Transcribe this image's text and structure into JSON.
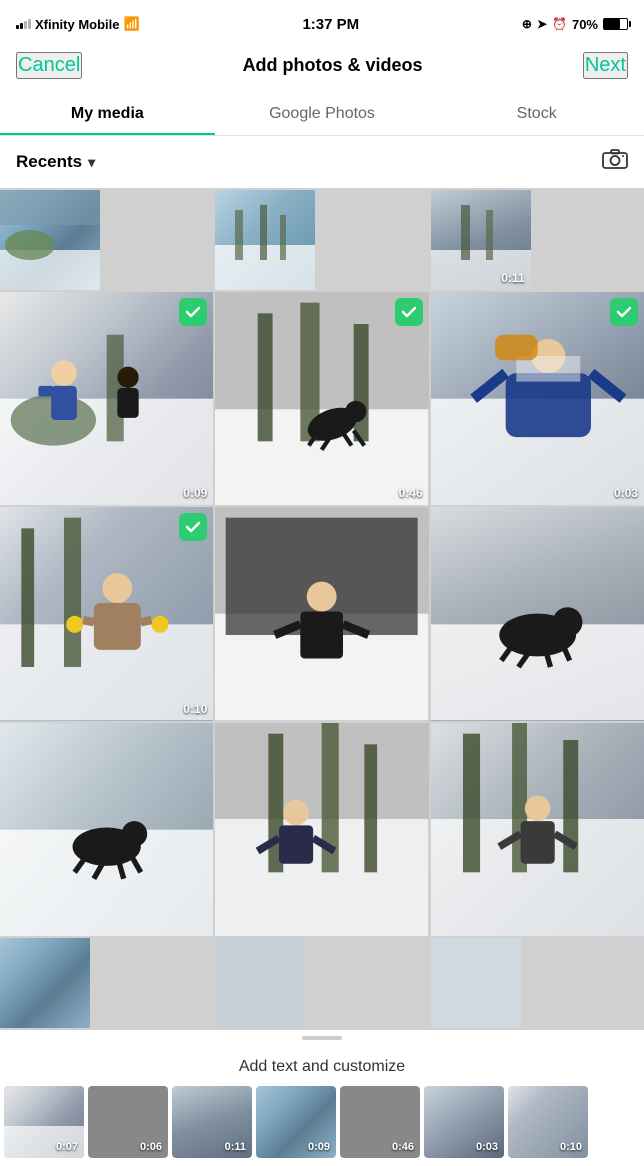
{
  "statusBar": {
    "carrier": "Xfinity Mobile",
    "time": "1:37 PM",
    "battery": "70%"
  },
  "nav": {
    "cancel": "Cancel",
    "title": "Add photos & videos",
    "next": "Next"
  },
  "tabs": [
    {
      "label": "My media",
      "active": true
    },
    {
      "label": "Google Photos",
      "active": false
    },
    {
      "label": "Stock",
      "active": false
    }
  ],
  "filter": {
    "label": "Recents"
  },
  "photos": [
    {
      "id": "p1",
      "selected": false,
      "duration": null,
      "colorClass": "snow1"
    },
    {
      "id": "p2",
      "selected": false,
      "duration": null,
      "colorClass": "snow2"
    },
    {
      "id": "p3",
      "selected": false,
      "duration": "0:11",
      "colorClass": "snow3"
    },
    {
      "id": "p4",
      "selected": true,
      "duration": "0:09",
      "colorClass": "snow4"
    },
    {
      "id": "p5",
      "selected": true,
      "duration": "0:46",
      "colorClass": "snow5"
    },
    {
      "id": "p6",
      "selected": true,
      "duration": "0:03",
      "colorClass": "snow6"
    },
    {
      "id": "p7",
      "selected": true,
      "duration": "0:10",
      "colorClass": "snow7"
    },
    {
      "id": "p8",
      "selected": false,
      "duration": null,
      "colorClass": "snow8"
    },
    {
      "id": "p9",
      "selected": false,
      "duration": null,
      "colorClass": "snow9"
    },
    {
      "id": "p10",
      "selected": false,
      "duration": null,
      "colorClass": "snow10"
    },
    {
      "id": "p11",
      "selected": false,
      "duration": null,
      "colorClass": "snow11"
    },
    {
      "id": "p12",
      "selected": false,
      "duration": null,
      "colorClass": "snow12"
    },
    {
      "id": "p13",
      "selected": false,
      "duration": null,
      "colorClass": "snow1"
    },
    {
      "id": "p14",
      "selected": false,
      "duration": null,
      "colorClass": "snow2"
    },
    {
      "id": "p15",
      "selected": false,
      "duration": null,
      "colorClass": "snow3"
    }
  ],
  "bottomText": "Add text and customize",
  "thumbnails": [
    {
      "duration": "0:07",
      "colorClass": "snow4"
    },
    {
      "duration": "0:06",
      "colorClass": "snow5"
    },
    {
      "duration": "0:11",
      "colorClass": "snow3"
    },
    {
      "duration": "0:09",
      "colorClass": "snow1"
    },
    {
      "duration": "0:46",
      "colorClass": "snow5"
    },
    {
      "duration": "0:03",
      "colorClass": "snow6"
    },
    {
      "duration": "0:10",
      "colorClass": "snow7"
    }
  ]
}
